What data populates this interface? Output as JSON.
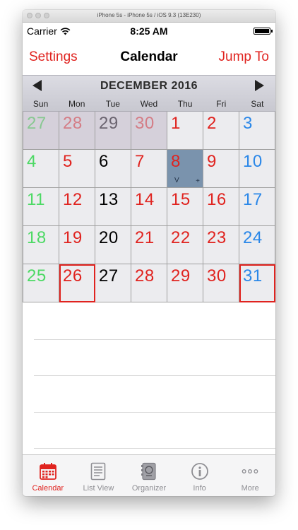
{
  "window": {
    "title": "iPhone 5s - iPhone 5s / iOS 9.3 (13E230)"
  },
  "status": {
    "carrier": "Carrier",
    "time": "8:25 AM"
  },
  "navbar": {
    "left": "Settings",
    "title": "Calendar",
    "right": "Jump To"
  },
  "calendar": {
    "month": "DECEMBER 2016",
    "weekdays": [
      "Sun",
      "Mon",
      "Tue",
      "Wed",
      "Thu",
      "Fri",
      "Sat"
    ],
    "weeks": [
      [
        "27",
        "28",
        "29",
        "30",
        "1",
        "2",
        "3"
      ],
      [
        "4",
        "5",
        "6",
        "7",
        "8",
        "9",
        "10"
      ],
      [
        "11",
        "12",
        "13",
        "14",
        "15",
        "16",
        "17"
      ],
      [
        "18",
        "19",
        "20",
        "21",
        "22",
        "23",
        "24"
      ],
      [
        "25",
        "26",
        "27",
        "28",
        "29",
        "30",
        "31"
      ]
    ],
    "selected_cell_marks": {
      "left": "V",
      "right": "+"
    }
  },
  "tabbar": {
    "items": [
      {
        "label": "Calendar",
        "icon": "calendar-icon"
      },
      {
        "label": "List View",
        "icon": "list-icon"
      },
      {
        "label": "Organizer",
        "icon": "organizer-icon"
      },
      {
        "label": "Info",
        "icon": "info-icon"
      },
      {
        "label": "More",
        "icon": "more-icon"
      }
    ]
  },
  "colors": {
    "accent": "#e0231f",
    "selected_day": "#7a93ad",
    "weekend_sunday": "#4cd964",
    "weekend_saturday": "#2a87e8"
  }
}
